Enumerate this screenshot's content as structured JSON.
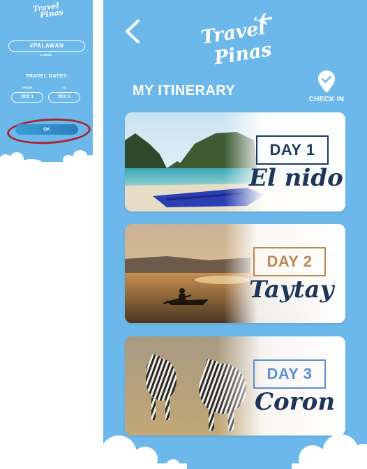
{
  "left_screen": {
    "logo_line1": "Travel",
    "logo_line2": "Pinas",
    "tag_value": "#PALAWAN",
    "tag_label": "LABEL",
    "dates_title": "TRAVEL DATES",
    "from_label": "FROM",
    "to_label": "TO",
    "from_value": "DEC 1",
    "to_value": "DEC 5",
    "ok_label": "OK"
  },
  "header": {
    "logo_line1": "Travel",
    "logo_line2": "Pinas",
    "back_icon": "chevron-left-icon"
  },
  "page_title": "MY ITINERARY",
  "check_in": {
    "label": "CHECK IN",
    "icon": "location-pin-icon"
  },
  "days": [
    {
      "day": "DAY 1",
      "place": "El nido",
      "accent": "#1f3a5f"
    },
    {
      "day": "DAY 2",
      "place": "Taytay",
      "accent": "#b98a52"
    },
    {
      "day": "DAY 3",
      "place": "Coron",
      "accent": "#5e8fd6"
    }
  ],
  "colors": {
    "background": "#6cb8ea",
    "ok_highlight": "#a8262c",
    "text_dark": "#1d3557"
  }
}
